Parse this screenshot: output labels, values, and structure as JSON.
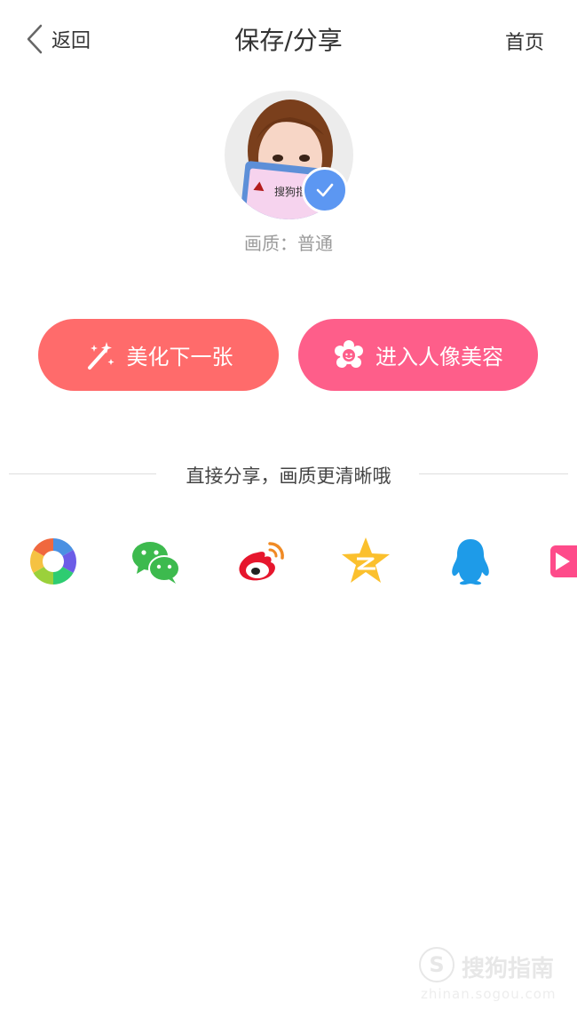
{
  "header": {
    "back_label": "返回",
    "title": "保存/分享",
    "home_label": "首页"
  },
  "preview": {
    "quality_text": "画质：普通",
    "avatar_overlay_text": "搜狗指"
  },
  "actions": {
    "beautify_next_label": "美化下一张",
    "portrait_beauty_label": "进入人像美容"
  },
  "share": {
    "hint": "直接分享，画质更清晰哦",
    "targets": [
      {
        "name": "camera-shutter-icon"
      },
      {
        "name": "wechat-icon"
      },
      {
        "name": "weibo-icon"
      },
      {
        "name": "qzone-icon"
      },
      {
        "name": "qq-icon"
      },
      {
        "name": "video-play-icon"
      }
    ]
  },
  "watermark": {
    "brand": "搜狗指南",
    "url": "zhinan.sogou.com"
  },
  "colors": {
    "beautify_button": "#ff6b6b",
    "portrait_button": "#fe5e8a",
    "check_badge": "#5c97f2"
  }
}
